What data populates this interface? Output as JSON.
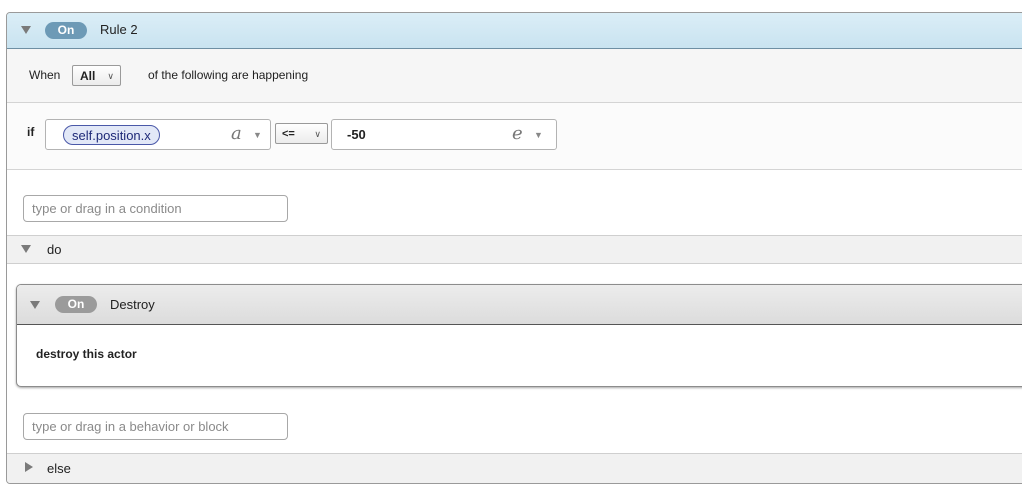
{
  "rule": {
    "toggle": "On",
    "title": "Rule 2",
    "when_label": "When",
    "match_select": "All",
    "when_suffix": "of the following are happening",
    "condition": {
      "keyword": "if",
      "attribute": "self.position.x",
      "attribute_kind": "a",
      "operator": "<=",
      "value": "-50",
      "value_kind": "e"
    },
    "condition_input_placeholder": "type or drag in a condition",
    "do_label": "do",
    "else_label": "else",
    "behavior_input_placeholder": "type or drag in a behavior or block"
  },
  "behavior": {
    "toggle": "On",
    "title": "Destroy",
    "description": "destroy this actor"
  },
  "colors": {
    "rule_header": "#c9e3f0",
    "rule_pill": "#6d9ab6",
    "behavior_pill": "#9b9b9b",
    "token_border": "#4a58a8"
  }
}
